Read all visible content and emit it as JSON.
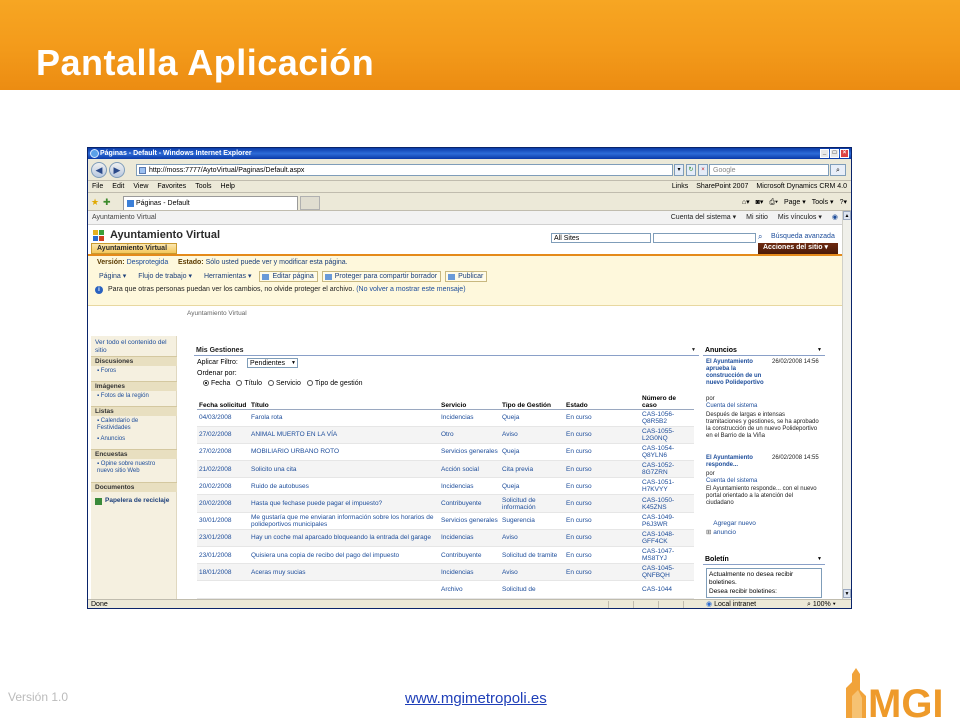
{
  "slide": {
    "title": "Pantalla Aplicación",
    "version": "Versión 1.0",
    "link": "www.mgimetropoli.es",
    "logo_text": "MGI"
  },
  "browser": {
    "title": "Páginas - Default - Windows Internet Explorer",
    "address": "http://moss:7777/AytoVirtual/Paginas/Default.aspx",
    "search_placeholder": "Google",
    "menu": [
      "File",
      "Edit",
      "View",
      "Favorites",
      "Tools",
      "Help"
    ],
    "links": [
      "Links",
      "SharePoint 2007",
      "Microsoft Dynamics CRM 4.0"
    ],
    "tab_label": "Páginas - Default",
    "commands": [
      "Page ▾",
      "Tools ▾"
    ],
    "status_done": "Done",
    "status_zone": "Local intranet",
    "status_zoom": "100%"
  },
  "sharepoint": {
    "site_crumb": "Ayuntamiento Virtual",
    "top_links": [
      "Cuenta del sistema ▾",
      "Mi sitio",
      "Mis vínculos ▾"
    ],
    "site_title": "Ayuntamiento Virtual",
    "search_scope": "All Sites",
    "advanced_search": "Búsqueda avanzada",
    "top_tab": "Ayuntamiento Virtual",
    "site_actions": "Acciones del sitio ▾",
    "version_label": "Versión:",
    "version_value": "Desprotegida",
    "status_label": "Estado:",
    "status_value": "Sólo usted puede ver y modificar esta página.",
    "toolbar": {
      "pagina": "Página ▾",
      "flujo": "Flujo de trabajo ▾",
      "herramientas": "Herramientas ▾",
      "editar": "Editar página",
      "proteger": "Proteger para compartir borrador",
      "publicar": "Publicar"
    },
    "info_text": "Para que otras personas puedan ver los cambios, no olvide proteger el archivo.",
    "info_link": "(No volver a mostrar este mensaje)",
    "page_breadcrumb": "Ayuntamiento Virtual"
  },
  "leftnav": {
    "view_all": "Ver todo el contenido del sitio",
    "sections": [
      {
        "header": "Discusiones",
        "items": [
          "Foros"
        ]
      },
      {
        "header": "Imágenes",
        "items": [
          "Fotos de la región"
        ]
      },
      {
        "header": "Listas",
        "items": [
          "Calendario de Festividades",
          "Anuncios"
        ]
      },
      {
        "header": "Encuestas",
        "items": [
          "Opine sobre nuestro nuevo sitio Web"
        ]
      },
      {
        "header": "Documentos",
        "items": []
      }
    ],
    "recycle": "Papelera de reciclaje"
  },
  "gestiones": {
    "title": "Mis Gestiones",
    "filter_label": "Aplicar Filtro:",
    "filter_value": "Pendientes",
    "order_label": "Ordenar por:",
    "order_options": [
      "Fecha",
      "Título",
      "Servicio",
      "Tipo de gestión"
    ],
    "columns": [
      "Fecha solicitud",
      "Título",
      "Servicio",
      "Tipo de Gestión",
      "Estado",
      "Número de caso"
    ],
    "rows": [
      [
        "04/03/2008",
        "Farola rota",
        "Incidencias",
        "Queja",
        "En curso",
        "CAS-1056-Q8R5B2"
      ],
      [
        "27/02/2008",
        "ANIMAL MUERTO EN LA VÍA",
        "Otro",
        "Aviso",
        "En curso",
        "CAS-1055-L2G0NQ"
      ],
      [
        "27/02/2008",
        "MOBILIARIO URBANO ROTO",
        "Servicios generales",
        "Queja",
        "En curso",
        "CAS-1054-Q8YLN6"
      ],
      [
        "21/02/2008",
        "Solicito una cita",
        "Acción social",
        "Cita previa",
        "En curso",
        "CAS-1052-8G7ZRN"
      ],
      [
        "20/02/2008",
        "Ruido de autobuses",
        "Incidencias",
        "Queja",
        "En curso",
        "CAS-1051-H7KVYY"
      ],
      [
        "20/02/2008",
        "Hasta que fechase puede pagar el impuesto?",
        "Contribuyente",
        "Solicitud de información",
        "En curso",
        "CAS-1050-K45ZNS"
      ],
      [
        "30/01/2008",
        "Me gustaría que me enviaran información sobre los horarios de polideportivos municipales",
        "Servicios generales",
        "Sugerencia",
        "En curso",
        "CAS-1049-P6J3WR"
      ],
      [
        "23/01/2008",
        "Hay un coche mal aparcado bloqueando la entrada del garage",
        "Incidencias",
        "Aviso",
        "En curso",
        "CAS-1048-GFF4CK"
      ],
      [
        "23/01/2008",
        "Quisiera una copia de recibo del pago del impuesto",
        "Contribuyente",
        "Solicitud de tramite",
        "En curso",
        "CAS-1047-MS8TYJ"
      ],
      [
        "18/01/2008",
        "Aceras muy sucias",
        "Incidencias",
        "Aviso",
        "En curso",
        "CAS-1045-QNFBQH"
      ],
      [
        "",
        "",
        "Archivo",
        "Solicitud de",
        "",
        "CAS-1044"
      ]
    ]
  },
  "anuncios": {
    "title": "Anuncios",
    "items": [
      {
        "title": "El Ayuntamiento aprueba la construcción de un nuevo Polideportivo",
        "date": "26/02/2008 14:56",
        "by": "por",
        "author": "Cuenta del sistema",
        "body": "Después de largas e intensas tramitaciones y gestiones, se ha aprobado la construcción de un nuevo Polideportivo en el Barrio de la Viña"
      },
      {
        "title": "El Ayuntamiento responde...",
        "date": "26/02/2008 14:55",
        "by": "por",
        "author": "Cuenta del sistema",
        "body": "El Ayuntamiento responde... con el nuevo portal orientado a la atención del ciudadano"
      }
    ],
    "add": "Agregar nuevo anuncio"
  },
  "boletin": {
    "title": "Boletín",
    "text1": "Actualmente no desea recibir boletines.",
    "text2": "Desea recibir boletines:"
  }
}
